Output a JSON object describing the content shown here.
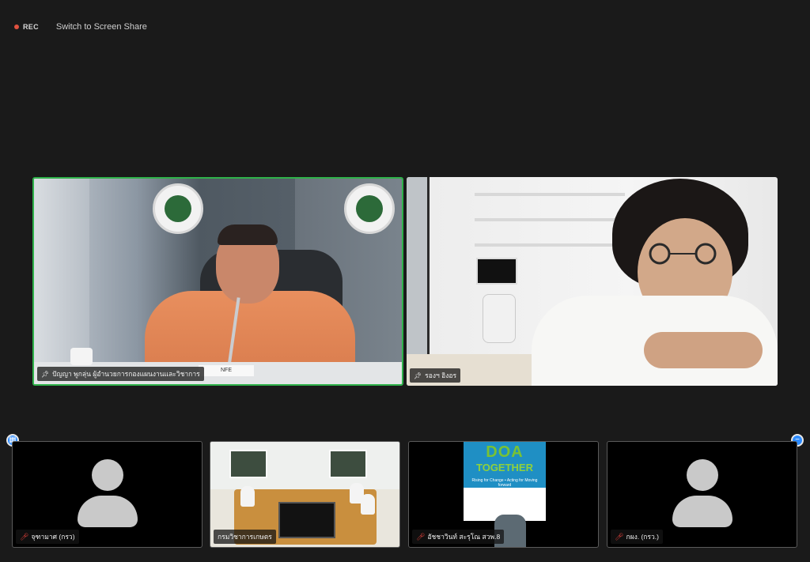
{
  "toolbar": {
    "rec_label": "REC",
    "switch_label": "Switch to Screen Share"
  },
  "icons": {
    "record": "record-dot-icon",
    "pin": "pin-icon",
    "muted": "muted-microphone-icon",
    "layout": "gallery-view-icon",
    "minimize": "minimize-icon"
  },
  "colors": {
    "active_speaker_border": "#2fb24a",
    "muted_red": "#e0403a",
    "accent_blue": "#2d8cff"
  },
  "main_tiles": [
    {
      "name": "ปัญญา พูกลุ่น ผู้อำนวยการกองแผนงานและวิชาการ",
      "pinned": true,
      "active_speaker": true,
      "desk_plate": "NFE"
    },
    {
      "name": "รองฯ อิงอร",
      "pinned": true,
      "active_speaker": false
    }
  ],
  "thumbnail_tiles": [
    {
      "name": "จุฑามาศ (กรว)",
      "muted": true,
      "video": false
    },
    {
      "name": "กรมวิชาการเกษตร",
      "muted": false,
      "video": true
    },
    {
      "name": "อัชชาวินท์ สะรุโณ สวพ.8",
      "muted": true,
      "video": true
    },
    {
      "name": "กผง. (กรว.)",
      "muted": true,
      "video": false
    }
  ],
  "doa_banner": {
    "line1": "DOA",
    "line2": "TOGETHER",
    "tagline": "Rising for Change • Acting for Moving forward"
  }
}
